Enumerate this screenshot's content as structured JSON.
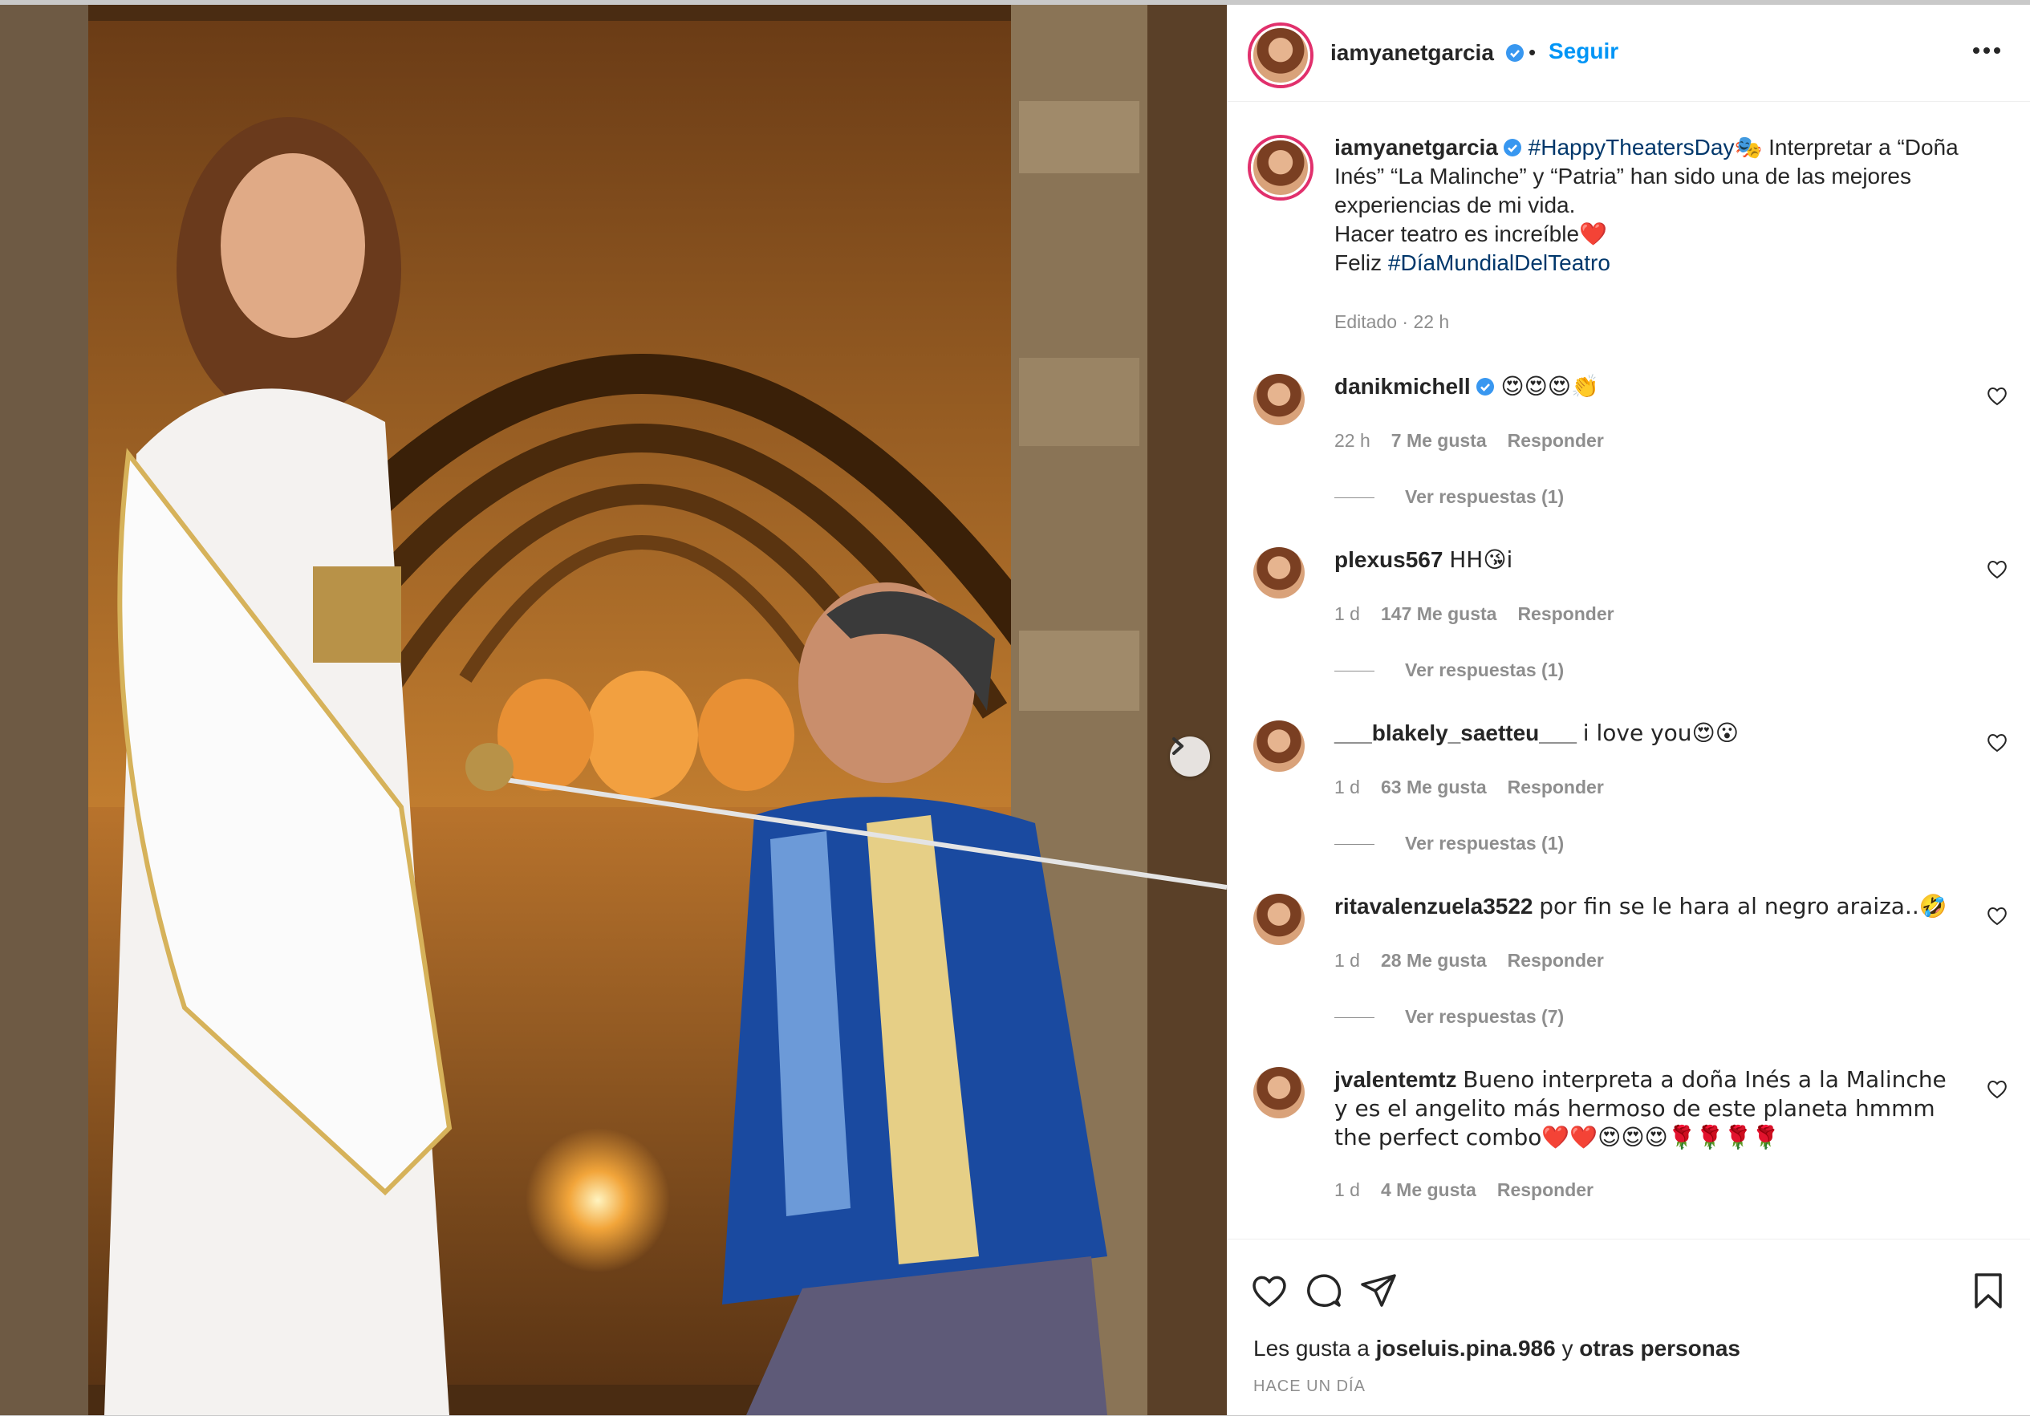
{
  "post": {
    "username": "iamyanetgarcia",
    "follow_label": "Seguir",
    "separator": "•",
    "caption": {
      "hashtag1": "#HappyTheatersDay",
      "emoji1": "🎭",
      "text1": " Interpretar a “Doña Inés” “La Malinche” y “Patria” han sido una de las mejores experiencias de mi vida.",
      "text2": "Hacer teatro es increíble",
      "emoji2": "❤️",
      "text3_prefix": "Feliz ",
      "hashtag2": "#DíaMundialDelTeatro",
      "meta": "Editado · 22 h"
    }
  },
  "comments": [
    {
      "username": "danikmichell",
      "verified": true,
      "text": "😍😍😍👏",
      "time": "22 h",
      "likes": "7 Me gusta",
      "reply_label": "Responder",
      "view_replies": "Ver respuestas (1)"
    },
    {
      "username": "plexus567",
      "verified": false,
      "text": "HH😘i",
      "time": "1 d",
      "likes": "147 Me gusta",
      "reply_label": "Responder",
      "view_replies": "Ver respuestas (1)"
    },
    {
      "username": "___blakely_saetteu___",
      "verified": false,
      "text": "i love you😍😮",
      "time": "1 d",
      "likes": "63 Me gusta",
      "reply_label": "Responder",
      "view_replies": "Ver respuestas (1)"
    },
    {
      "username": "ritavalenzuela3522",
      "verified": false,
      "text": "por fin se le hara al negro araiza..🤣",
      "time": "1 d",
      "likes": "28 Me gusta",
      "reply_label": "Responder",
      "view_replies": "Ver respuestas (7)"
    },
    {
      "username": "jvalentemtz",
      "verified": false,
      "text": "Bueno interpreta a doña Inés a la Malinche y es el angelito más hermoso de este planeta hmmm the perfect combo❤️❤️😍😍😍🌹🌹🌹🌹",
      "time": "1 d",
      "likes": "4 Me gusta",
      "reply_label": "Responder",
      "view_replies": ""
    }
  ],
  "footer": {
    "likes_prefix": "Les gusta a ",
    "likes_user": "joseluis.pina.986",
    "likes_middle": " y ",
    "likes_others": "otras personas",
    "timestamp": "HACE UN DÍA"
  },
  "icons": {
    "verified": "verified-badge-icon",
    "more": "more-options-icon",
    "like": "heart-icon",
    "comment": "comment-icon",
    "share": "share-icon",
    "save": "bookmark-icon",
    "next": "chevron-right-icon"
  },
  "colors": {
    "link_blue": "#0095f6",
    "hashtag": "#00376b",
    "muted": "#8e8e8e",
    "text": "#262626",
    "verified": "#3897f0"
  }
}
